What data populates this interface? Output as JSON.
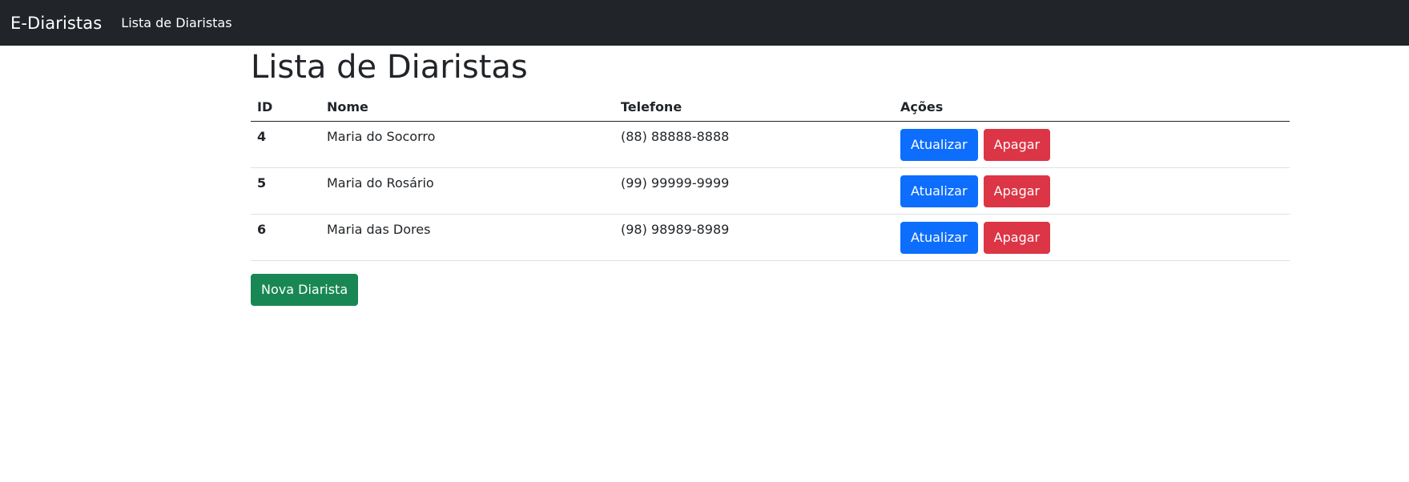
{
  "navbar": {
    "brand": "E-Diaristas",
    "link": "Lista de Diaristas"
  },
  "main": {
    "title": "Lista de Diaristas",
    "table": {
      "headers": {
        "id": "ID",
        "nome": "Nome",
        "telefone": "Telefone",
        "acoes": "Ações"
      },
      "rows": [
        {
          "id": "4",
          "nome": "Maria do Socorro",
          "telefone": "(88) 88888-8888",
          "update_label": "Atualizar",
          "delete_label": "Apagar"
        },
        {
          "id": "5",
          "nome": "Maria do Rosário",
          "telefone": "(99) 99999-9999",
          "update_label": "Atualizar",
          "delete_label": "Apagar"
        },
        {
          "id": "6",
          "nome": "Maria das Dores",
          "telefone": "(98) 98989-8989",
          "update_label": "Atualizar",
          "delete_label": "Apagar"
        }
      ]
    },
    "new_button_label": "Nova Diarista"
  },
  "colors": {
    "navbar_bg": "#212529",
    "primary": "#0d6efd",
    "danger": "#dc3545",
    "success": "#198754"
  }
}
